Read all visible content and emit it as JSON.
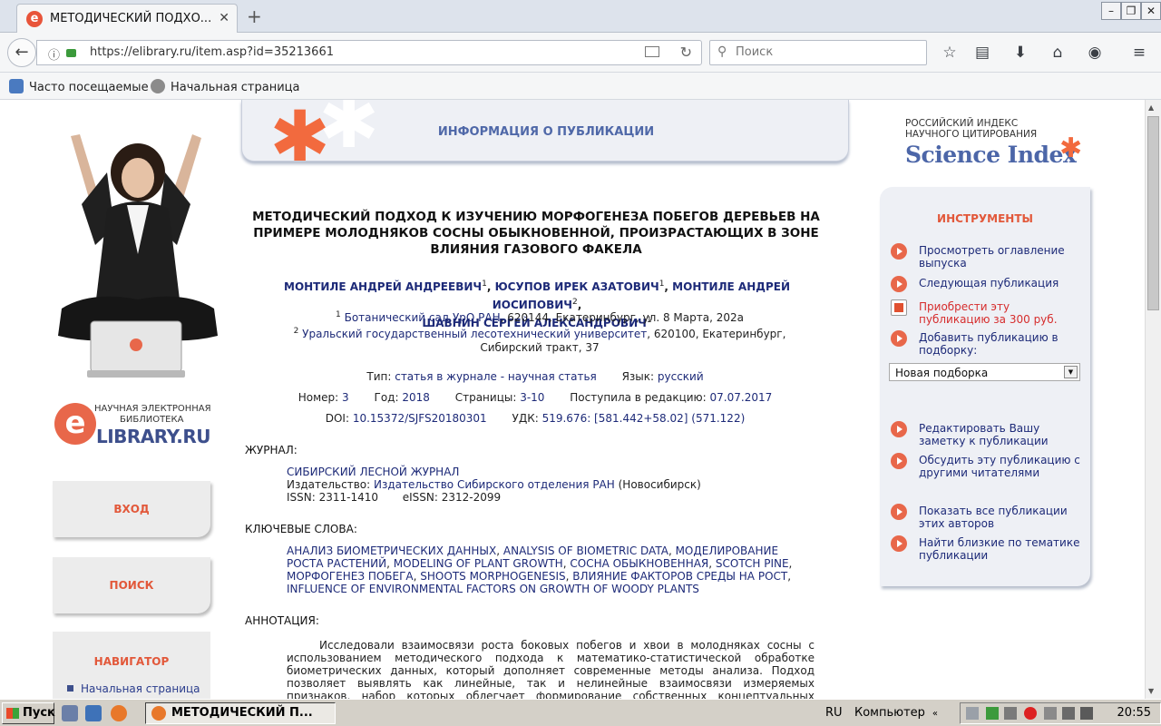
{
  "browser": {
    "tab_title": "МЕТОДИЧЕСКИЙ ПОДХО...",
    "url": "https://elibrary.ru/item.asp?id=35213661",
    "search_placeholder": "Поиск",
    "bookmarks": [
      "Часто посещаемые",
      "Начальная страница"
    ]
  },
  "left": {
    "logo_line1": "НАУЧНАЯ ЭЛЕКТРОННАЯ",
    "logo_line2": "БИБЛИОТЕКА",
    "logo_brand": "LIBRARY.RU",
    "login": "ВХОД",
    "search": "ПОИСК",
    "navigator_title": "НАВИГАТОР",
    "navigator_items": [
      "Начальная страница"
    ]
  },
  "header": {
    "title": "ИНФОРМАЦИЯ О ПУБЛИКАЦИИ"
  },
  "article": {
    "title": "МЕТОДИЧЕСКИЙ ПОДХОД К ИЗУЧЕНИЮ МОРФОГЕНЕЗА ПОБЕГОВ ДЕРЕВЬЕВ НА ПРИМЕРЕ МОЛОДНЯКОВ СОСНЫ ОБЫКНОВЕННОЙ, ПРОИЗРАСТАЮЩИХ В ЗОНЕ ВЛИЯНИЯ ГАЗОВОГО ФАКЕЛА",
    "authors": [
      {
        "name": "МОНТИЛЕ АНДРЕЙ АНДРЕЕВИЧ",
        "aff": "1"
      },
      {
        "name": "ЮСУПОВ ИРЕК АЗАТОВИЧ",
        "aff": "1"
      },
      {
        "name": "МОНТИЛЕ АНДРЕЙ ИОСИПОВИЧ",
        "aff": "2"
      },
      {
        "name": "ШАВНИН СЕРГЕЙ АЛЕКСАНДРОВИЧ",
        "aff": "1"
      }
    ],
    "affiliations": [
      {
        "num": "1",
        "org": "Ботанический сад УрО РАН",
        "addr": ", 620144, Екатеринбург, ул. 8 Марта, 202а"
      },
      {
        "num": "2",
        "org": "Уральский государственный лесотехнический университет",
        "addr": ", 620100, Екатеринбург, Сибирский тракт, 37"
      }
    ],
    "type_label": "Тип:",
    "type_value": "статья в журнале - научная статья",
    "lang_label": "Язык:",
    "lang_value": "русский",
    "number_label": "Номер:",
    "number_value": "3",
    "year_label": "Год:",
    "year_value": "2018",
    "pages_label": "Страницы:",
    "pages_value": "3-10",
    "received_label": "Поступила в редакцию:",
    "received_value": "07.07.2017",
    "doi_label": "DOI:",
    "doi_value": "10.15372/SJFS20180301",
    "udk_label": "УДК:",
    "udk_value": "519.676: [581.442+58.02] (571.122)",
    "journal_label": "ЖУРНАЛ:",
    "journal_name": "СИБИРСКИЙ ЛЕСНОЙ ЖУРНАЛ",
    "publisher_label": "Издательство:",
    "publisher_value": "Издательство Сибирского отделения РАН",
    "publisher_city": " (Новосибирск)",
    "issn": "ISSN: 2311-1410",
    "eissn": "eISSN: 2312-2099",
    "keywords_label": "КЛЮЧЕВЫЕ СЛОВА:",
    "keywords": [
      "АНАЛИЗ БИОМЕТРИЧЕСКИХ ДАННЫХ",
      "ANALYSIS OF BIOMETRIC DATA",
      "МОДЕЛИРОВАНИЕ РОСТА РАСТЕНИЙ",
      "MODELING OF PLANT GROWTH",
      "СОСНА ОБЫКНОВЕННАЯ",
      "SCOTCH PINE",
      "МОРФОГЕНЕЗ ПОБЕГА",
      "SHOOTS MORPHOGENESIS",
      "ВЛИЯНИЕ ФАКТОРОВ СРЕДЫ НА РОСТ",
      "INFLUENCE OF ENVIRONMENTAL FACTORS ON GROWTH OF WOODY PLANTS"
    ],
    "abstract_label": "АННОТАЦИЯ:",
    "abstract": "Исследовали взаимосвязи роста боковых побегов и хвои в молодняках сосны с использованием методического подхода к математико-статистической обработке биометрических данных, который дополняет современные методы анализа. Подход позволяет выявлять как линейные, так и нелинейные взаимосвязи измеряемых признаков, набор которых облегчает формирование собственных концептуальных моделей или верификацию известных и помогает"
  },
  "right": {
    "si_line1": "РОССИЙСКИЙ ИНДЕКС",
    "si_line2": "НАУЧНОГО ЦИТИРОВАНИЯ",
    "si_brand": "Science Index",
    "tools_title": "ИНСТРУМЕНТЫ",
    "tools": [
      "Просмотреть оглавление выпуска",
      "Следующая публикация",
      "Приобрести эту публикацию за 300 руб.",
      "Добавить публикацию в подборку:",
      "Редактировать Вашу заметку к публикации",
      "Обсудить эту публикацию с другими читателями",
      "Показать все публикации этих авторов",
      "Найти близкие по тематике публикации"
    ],
    "select_value": "Новая подборка"
  },
  "taskbar": {
    "start": "Пуск",
    "task_title": "МЕТОДИЧЕСКИЙ П...",
    "lang": "RU",
    "computer": "Компьютер",
    "clock": "20:55"
  }
}
